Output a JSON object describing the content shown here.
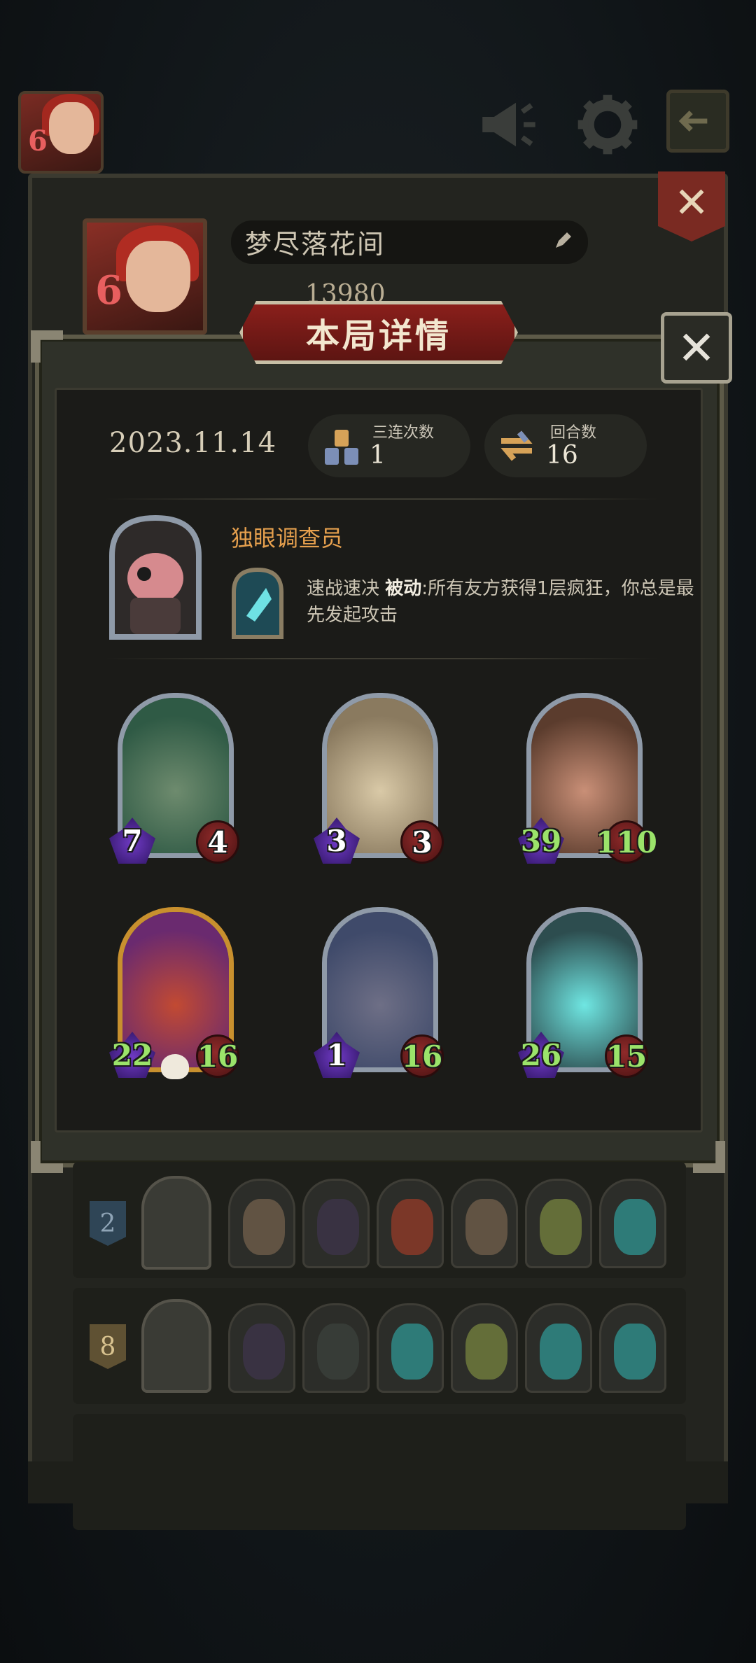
{
  "hud": {
    "avatar_level": "6",
    "icons": [
      "megaphone-icon",
      "gear-icon",
      "exit-icon"
    ]
  },
  "profile": {
    "level": "6",
    "name": "梦尽落花间",
    "score": "13980"
  },
  "modal": {
    "title": "本局详情",
    "close_icon": "close-icon",
    "date": "2023.11.14",
    "stats": {
      "triple_label": "三连次数",
      "triple_value": "1",
      "rounds_label": "回合数",
      "rounds_value": "16"
    },
    "hero": {
      "name": "独眼调查员",
      "skill_name": "速战速决",
      "skill_type": "被动",
      "skill_desc": ":所有友方获得1层疯狂，你总是最先发起攻击"
    },
    "cards": [
      {
        "attack": "7",
        "health": "4",
        "attack_buffed": false,
        "health_buffed": false,
        "frame": "silver",
        "art": "horned-elf"
      },
      {
        "attack": "3",
        "health": "3",
        "attack_buffed": false,
        "health_buffed": false,
        "frame": "silver",
        "art": "scholar"
      },
      {
        "attack": "39",
        "health": "110",
        "attack_buffed": true,
        "health_buffed": true,
        "frame": "silver",
        "art": "brute"
      },
      {
        "attack": "22",
        "health": "16",
        "attack_buffed": true,
        "health_buffed": true,
        "frame": "gold",
        "art": "dragon"
      },
      {
        "attack": "1",
        "health": "16",
        "attack_buffed": false,
        "health_buffed": true,
        "frame": "silver",
        "art": "rat"
      },
      {
        "attack": "26",
        "health": "15",
        "attack_buffed": true,
        "health_buffed": true,
        "frame": "silver",
        "art": "ghost-zombie"
      }
    ]
  },
  "history": [
    {
      "rank": "2",
      "rank_style": "blue"
    },
    {
      "rank": "8",
      "rank_style": "gold"
    }
  ],
  "colors": {
    "accent_gold": "#e6a04e",
    "banner_red": "#8a1f1b",
    "buff_green": "#9be36a"
  }
}
